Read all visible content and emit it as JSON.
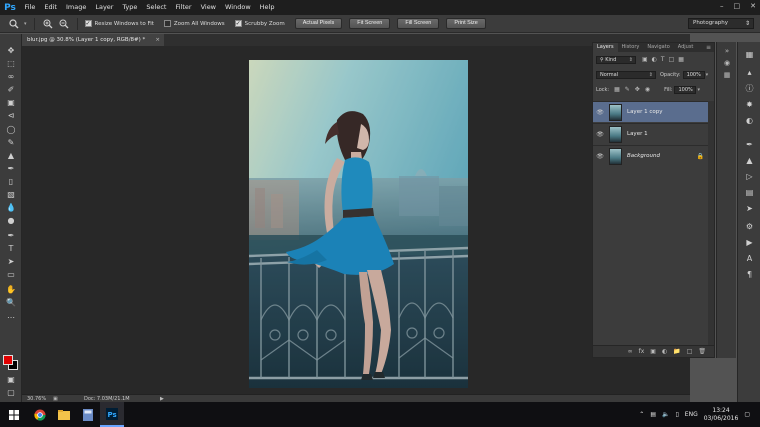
{
  "menubar": {
    "items": [
      "File",
      "Edit",
      "Image",
      "Layer",
      "Type",
      "Select",
      "Filter",
      "View",
      "Window",
      "Help"
    ]
  },
  "options": {
    "resize_windows": "Resize Windows to Fit",
    "zoom_all": "Zoom All Windows",
    "scrubby_zoom": "Scrubby Zoom",
    "actual_pixels": "Actual Pixels",
    "fit_screen": "Fit Screen",
    "fill_screen": "Fill Screen",
    "print_size": "Print Size",
    "workspace": "Photography"
  },
  "document": {
    "tab_title": "blur.jpg @ 30.8% (Layer 1 copy, RGB/8#) *",
    "zoom": "30.76%",
    "doc_size": "Doc: 7.03M/21.1M"
  },
  "layers_panel": {
    "tabs": [
      "Layers",
      "History",
      "Navigato",
      "Adjust"
    ],
    "kind_filter": "Kind",
    "blend_mode": "Normal",
    "opacity_label": "Opacity:",
    "opacity_value": "100%",
    "lock_label": "Lock:",
    "fill_label": "Fill:",
    "fill_value": "100%",
    "layers": [
      {
        "name": "Layer 1 copy",
        "selected": true
      },
      {
        "name": "Layer 1",
        "selected": false
      },
      {
        "name": "Background",
        "selected": false
      }
    ]
  },
  "colors": {
    "foreground": "#e00000",
    "background": "#000000",
    "ps_blue": "#31a8ff",
    "selected_layer": "#5a6d8e"
  },
  "taskbar": {
    "time": "13:24",
    "date": "03/06/2016",
    "language": "ENG"
  }
}
